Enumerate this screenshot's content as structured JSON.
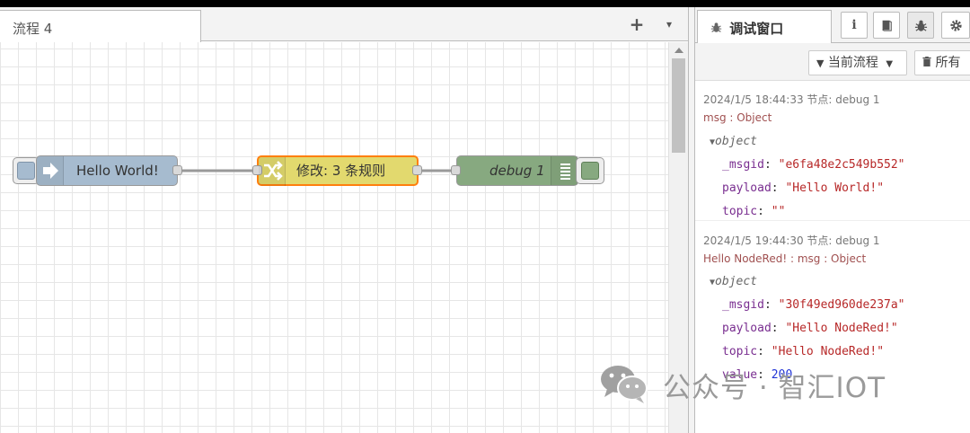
{
  "workspace": {
    "tab_label": "流程 4",
    "add_icon": "+",
    "menu_icon": "▾"
  },
  "flow": {
    "inject_label": "Hello World!",
    "change_label": "修改: 3 条规则",
    "debug_label": "debug 1"
  },
  "sidebar": {
    "active_tab_label": "调试窗口",
    "info_icon": "i",
    "book_icon": "book-icon",
    "debug_icon": "bug-icon",
    "settings_icon": "gear-icon",
    "filter_label": "当前流程",
    "clear_label": "所有"
  },
  "messages": [
    {
      "meta": "2024/1/5 18:44:33   节点: debug 1",
      "topic": "msg : Object",
      "type": "object",
      "props": [
        {
          "key": "_msgid",
          "value": "\"e6fa48e2c549b552\""
        },
        {
          "key": "payload",
          "value": "\"Hello World!\""
        },
        {
          "key": "topic",
          "value": "\"\""
        }
      ]
    },
    {
      "meta": "2024/1/5 19:44:30   节点: debug 1",
      "topic": "Hello NodeRed! : msg : Object",
      "type": "object",
      "props": [
        {
          "key": "_msgid",
          "value": "\"30f49ed960de237a\""
        },
        {
          "key": "payload",
          "value": "\"Hello NodeRed!\""
        },
        {
          "key": "topic",
          "value": "\"Hello NodeRed!\""
        },
        {
          "key": "value",
          "value": "200"
        }
      ]
    }
  ],
  "watermark": {
    "text": "公众号 · 智汇IOT"
  },
  "colors": {
    "inject": "#a6bbcf",
    "change": "#e2d96e",
    "change_selected_border": "#ff7f0e",
    "debug": "#87a980"
  }
}
